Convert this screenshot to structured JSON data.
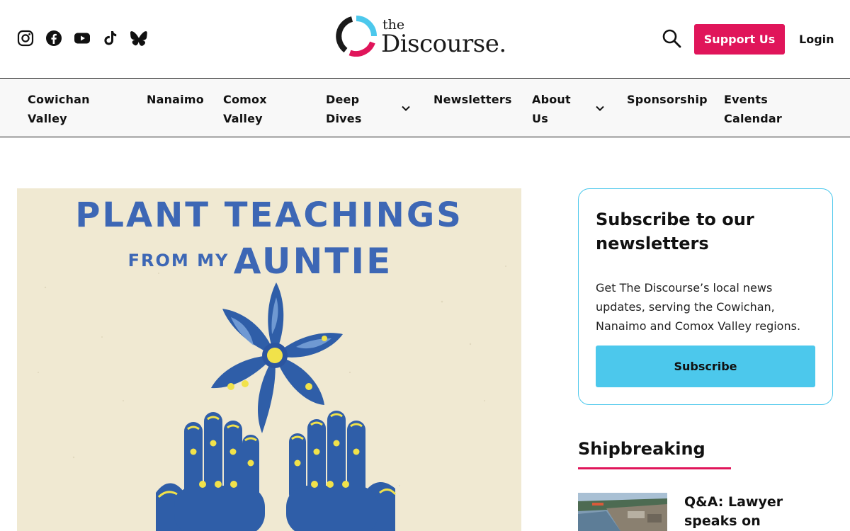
{
  "site": {
    "logo_small": "the",
    "logo_name": "Discourse."
  },
  "social": {
    "icons": [
      "instagram-icon",
      "facebook-icon",
      "youtube-icon",
      "tiktok-icon",
      "bluesky-icon"
    ]
  },
  "header": {
    "support_label": "Support Us",
    "login_label": "Login"
  },
  "nav": {
    "items": [
      {
        "line1": "Cowichan",
        "line2": "Valley"
      },
      {
        "line1": "Nanaimo",
        "line2": ""
      },
      {
        "line1": "Comox",
        "line2": "Valley"
      },
      {
        "line1": "Deep",
        "line2": "Dives"
      },
      {
        "line1": "Newsletters",
        "line2": ""
      },
      {
        "line1": "About",
        "line2": "Us"
      },
      {
        "line1": "Sponsorship",
        "line2": ""
      },
      {
        "line1": "Events",
        "line2": "Calendar"
      }
    ]
  },
  "hero": {
    "line1": "PLANT TEACHINGS",
    "line2a": "FROM MY",
    "line2b": "AUNTIE"
  },
  "subscribe": {
    "title": "Subscribe to our newsletters",
    "body": "Get The Discourse’s local news updates, serving the Cowichan, Nanaimo and Comox Valley regions.",
    "button": "Subscribe"
  },
  "section": {
    "title": "Shipbreaking",
    "story_title": "Q&A: Lawyer speaks on groundbreaking"
  },
  "colors": {
    "accent_pink": "#e0155a",
    "accent_blue": "#4cc8ec",
    "cover_blue": "#3d67b5"
  }
}
